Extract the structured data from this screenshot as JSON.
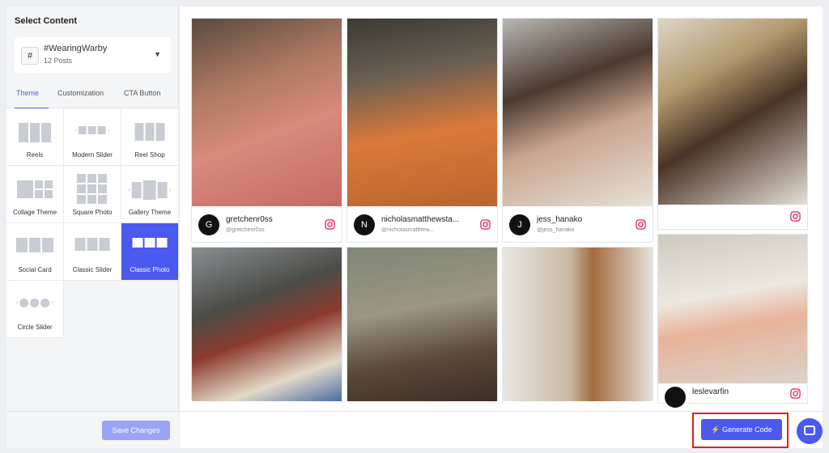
{
  "sidebar": {
    "title": "Select Content",
    "source": {
      "name": "#WearingWarby",
      "count": "12 Posts",
      "icon": "#"
    },
    "tabs": [
      "Theme",
      "Customization",
      "CTA Button"
    ],
    "themes": [
      "Reels",
      "Modern Slider",
      "Reel Shop",
      "Collage Theme",
      "Square Photo",
      "Gallery Theme",
      "Social Card",
      "Classic Slider",
      "Classic Photo",
      "Circle Slider"
    ],
    "save_label": "Save Changes"
  },
  "cards": [
    {
      "initial": "G",
      "name": "gretchenr0ss",
      "handle": "@gretchenr0ss"
    },
    {
      "initial": "N",
      "name": "nicholasmatthewsta...",
      "handle": "@nicholasmatthew..."
    },
    {
      "initial": "J",
      "name": "jess_hanako",
      "handle": "@jess_hanako"
    },
    {
      "initial": "",
      "name": "",
      "handle": ""
    },
    {
      "initial": "",
      "name": "",
      "handle": ""
    },
    {
      "initial": "",
      "name": "",
      "handle": ""
    },
    {
      "initial": "",
      "name": "",
      "handle": ""
    },
    {
      "initial": "",
      "name": "leslevarfin",
      "handle": ""
    }
  ],
  "footer": {
    "generate_label": "Generate Code"
  },
  "colors": {
    "accent": "#4b59ef",
    "highlight": "#e51c23"
  }
}
